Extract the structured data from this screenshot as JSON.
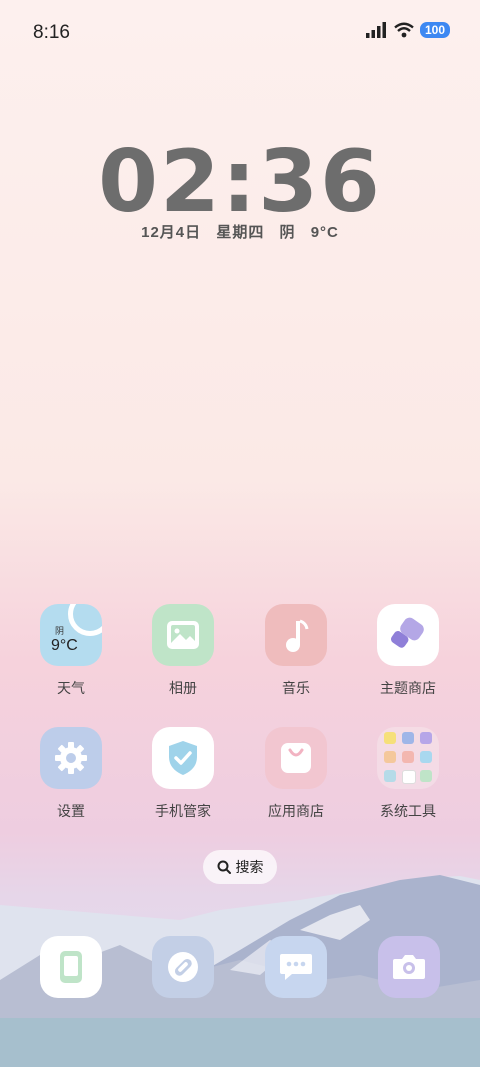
{
  "status_bar": {
    "time": "8:16",
    "battery": "100",
    "icons": [
      "signal-icon",
      "wifi-icon",
      "battery-icon"
    ]
  },
  "lockscreen_clock": {
    "time": "02:36",
    "date": "12月4日",
    "weekday": "星期四",
    "weather": "阴",
    "temperature": "9°C"
  },
  "apps": [
    {
      "label": "天气",
      "icon": "weather-icon",
      "widget_condition": "阴",
      "widget_temp": "9°C"
    },
    {
      "label": "相册",
      "icon": "gallery-icon"
    },
    {
      "label": "音乐",
      "icon": "music-note-icon"
    },
    {
      "label": "主题商店",
      "icon": "theme-store-icon"
    },
    {
      "label": "设置",
      "icon": "gear-icon"
    },
    {
      "label": "手机管家",
      "icon": "shield-check-icon"
    },
    {
      "label": "应用商店",
      "icon": "shopping-bag-icon"
    },
    {
      "label": "系统工具",
      "icon": "folder-icon"
    }
  ],
  "search": {
    "label": "搜索",
    "icon": "search-icon"
  },
  "dock": [
    {
      "icon": "phone-icon"
    },
    {
      "icon": "browser-compass-icon"
    },
    {
      "icon": "messages-icon"
    },
    {
      "icon": "camera-icon"
    }
  ],
  "colors": {
    "battery": "#3d88f2",
    "weather_tile": "#b4dcef",
    "gallery_tile": "#bfe4c8",
    "music_tile": "#efbcbd",
    "settings_tile": "#bdcdea",
    "store_tile": "#f2c6d0"
  }
}
